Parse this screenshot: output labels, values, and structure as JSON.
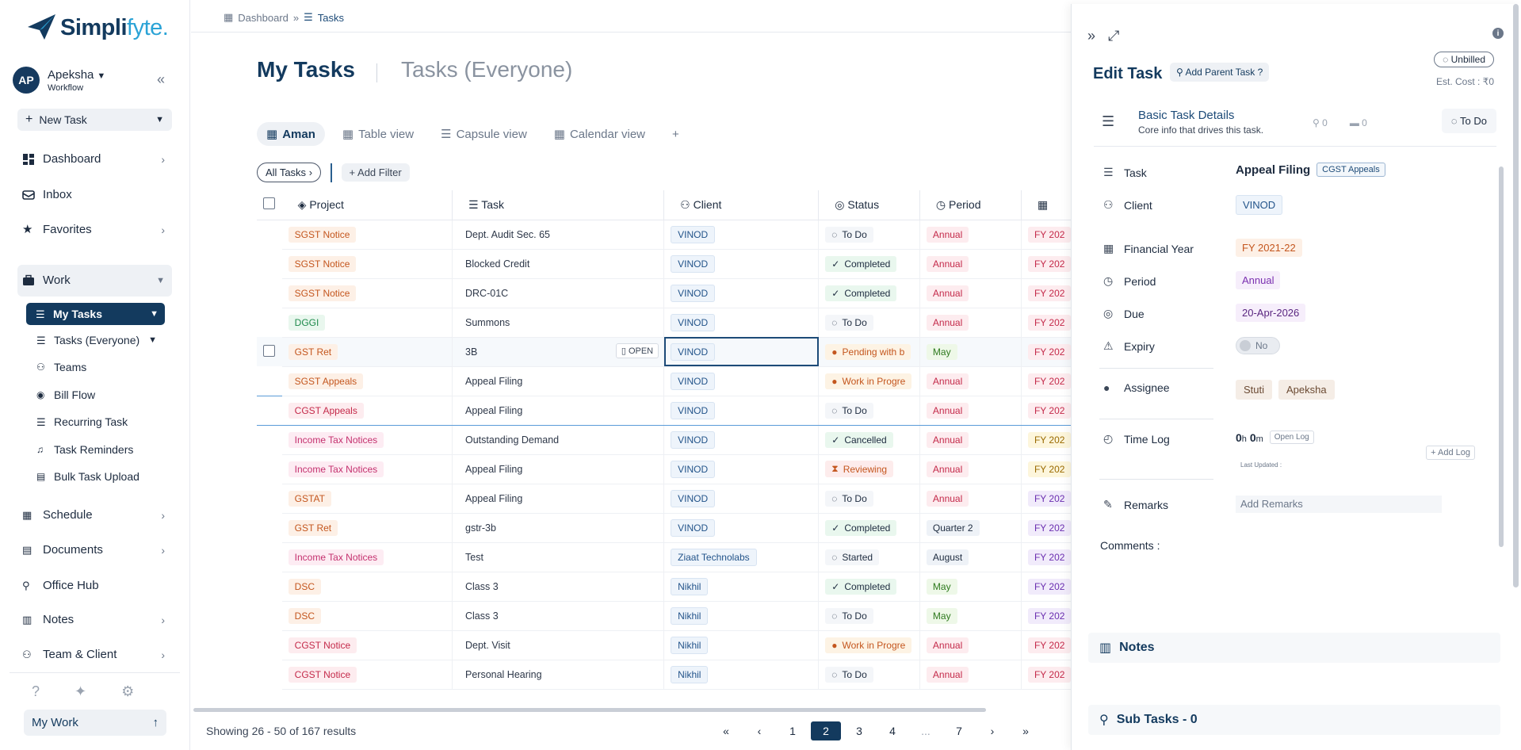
{
  "app": {
    "logo_main": "Simpli",
    "logo_accent": "fyte."
  },
  "user": {
    "initials": "AP",
    "name": "Apeksha",
    "subtitle": "Workflow"
  },
  "sidebar": {
    "new_task": "New Task",
    "items": [
      {
        "label": "Dashboard"
      },
      {
        "label": "Inbox"
      },
      {
        "label": "Favorites"
      },
      {
        "label": "Work"
      }
    ],
    "work_items": [
      {
        "label": "My Tasks"
      },
      {
        "label": "Tasks (Everyone)"
      },
      {
        "label": "Teams"
      },
      {
        "label": "Bill Flow"
      },
      {
        "label": "Recurring Task"
      },
      {
        "label": "Task Reminders"
      },
      {
        "label": "Bulk Task Upload"
      }
    ],
    "lower_items": [
      {
        "label": "Schedule"
      },
      {
        "label": "Documents"
      },
      {
        "label": "Office Hub"
      },
      {
        "label": "Notes"
      },
      {
        "label": "Team & Client"
      }
    ],
    "my_work": "My Work"
  },
  "breadcrumb": {
    "root": "Dashboard",
    "current": "Tasks"
  },
  "header": {
    "title": "My Tasks",
    "alt_title": "Tasks (Everyone)"
  },
  "views": [
    {
      "label": "Aman"
    },
    {
      "label": "Table view"
    },
    {
      "label": "Capsule view"
    },
    {
      "label": "Calendar view"
    }
  ],
  "filters": {
    "all_tasks": "All Tasks",
    "add_filter": "Add Filter"
  },
  "table": {
    "columns": [
      "Project",
      "Task",
      "Client",
      "Status",
      "Period"
    ],
    "open_label": "OPEN",
    "rows": [
      {
        "project": "SGST Notice",
        "task": "Dept. Audit Sec. 65",
        "client": "VINOD",
        "status": "To Do",
        "period": "Annual",
        "fy": "FY 202"
      },
      {
        "project": "SGST Notice",
        "task": "Blocked Credit",
        "client": "VINOD",
        "status": "Completed",
        "period": "Annual",
        "fy": "FY 202"
      },
      {
        "project": "SGST Notice",
        "task": "DRC-01C",
        "client": "VINOD",
        "status": "Completed",
        "period": "Annual",
        "fy": "FY 202"
      },
      {
        "project": "DGGI",
        "task": "Summons",
        "client": "VINOD",
        "status": "To Do",
        "period": "Annual",
        "fy": "FY 202"
      },
      {
        "project": "GST Ret",
        "task": "3B",
        "client": "VINOD",
        "status": "Pending with b",
        "period": "May",
        "fy": "FY 202"
      },
      {
        "project": "SGST Appeals",
        "task": "Appeal Filing",
        "client": "VINOD",
        "status": "Work in Progre",
        "period": "Annual",
        "fy": "FY 202"
      },
      {
        "project": "CGST Appeals",
        "task": "Appeal Filing",
        "client": "VINOD",
        "status": "To Do",
        "period": "Annual",
        "fy": "FY 202"
      },
      {
        "project": "Income Tax Notices",
        "task": "Outstanding Demand",
        "client": "VINOD",
        "status": "Cancelled",
        "period": "Annual",
        "fy": "FY 202"
      },
      {
        "project": "Income Tax Notices",
        "task": "Appeal Filing",
        "client": "VINOD",
        "status": "Reviewing",
        "period": "Annual",
        "fy": "FY 202"
      },
      {
        "project": "GSTAT",
        "task": "Appeal Filing",
        "client": "VINOD",
        "status": "To Do",
        "period": "Annual",
        "fy": "FY 202"
      },
      {
        "project": "GST Ret",
        "task": "gstr-3b",
        "client": "VINOD",
        "status": "Completed",
        "period": "Quarter 2",
        "fy": "FY 202"
      },
      {
        "project": "Income Tax Notices",
        "task": "Test",
        "client": "Ziaat Technolabs",
        "status": "Started",
        "period": "August",
        "fy": "FY 202"
      },
      {
        "project": "DSC",
        "task": "Class 3",
        "client": "Nikhil",
        "status": "Completed",
        "period": "May",
        "fy": "FY 202"
      },
      {
        "project": "DSC",
        "task": "Class 3",
        "client": "Nikhil",
        "status": "To Do",
        "period": "May",
        "fy": "FY 202"
      },
      {
        "project": "CGST Notice",
        "task": "Dept. Visit",
        "client": "Nikhil",
        "status": "Work in Progre",
        "period": "Annual",
        "fy": "FY 202"
      },
      {
        "project": "CGST Notice",
        "task": "Personal Hearing",
        "client": "Nikhil",
        "status": "To Do",
        "period": "Annual",
        "fy": "FY 202"
      }
    ]
  },
  "pagination": {
    "showing": "Showing 26 - 50 of 167 results",
    "first": "«",
    "prev": "‹",
    "next": "›",
    "last": "»",
    "pages": [
      "1",
      "2",
      "3",
      "4",
      "...",
      "7"
    ],
    "current": "2"
  },
  "edit_panel": {
    "title": "Edit Task",
    "add_parent": "Add Parent Task ?",
    "billing": "Unbilled",
    "est_cost": "Est. Cost : ₹0",
    "basic_title": "Basic Task Details",
    "basic_sub": "Core info that drives this task.",
    "subtask_count": "0",
    "folder_count": "0",
    "status": "To Do",
    "fields": {
      "task_label": "Task",
      "task_value": "Appeal Filing",
      "task_chip": "CGST Appeals",
      "client_label": "Client",
      "client_value": "VINOD",
      "fy_label": "Financial Year",
      "fy_value": "FY 2021-22",
      "period_label": "Period",
      "period_value": "Annual",
      "due_label": "Due",
      "due_value": "20-Apr-2026",
      "expiry_label": "Expiry",
      "expiry_value": "No",
      "assignee_label": "Assignee",
      "assignees": [
        "Stuti",
        "Apeksha"
      ],
      "timelog_label": "Time Log",
      "timelog_h": "0",
      "timelog_m": "0",
      "open_log": "Open Log",
      "add_log": "+ Add Log",
      "last_updated": "Last Updated :",
      "remarks_label": "Remarks",
      "remarks_placeholder": "Add Remarks"
    },
    "comments_label": "Comments :",
    "notes_label": "Notes",
    "subtasks_label": "Sub Tasks - 0"
  },
  "colors": {
    "brand": "#133a5e",
    "accent": "#2ba3d6"
  }
}
